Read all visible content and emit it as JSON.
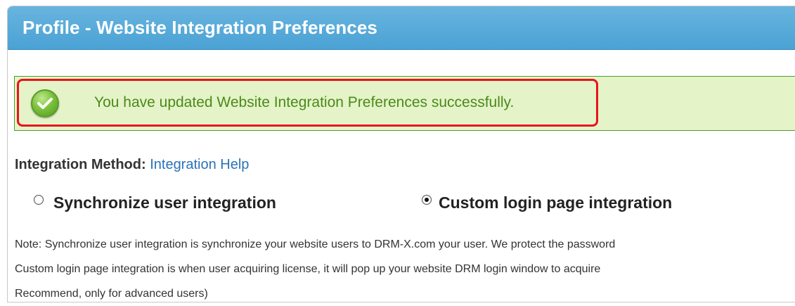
{
  "header": {
    "title": "Profile - Website Integration Preferences"
  },
  "alert": {
    "icon": "checkmark-icon",
    "message": "You have updated Website Integration Preferences successfully.",
    "colors": {
      "background": "#e5f3c8",
      "text": "#4a8a1a",
      "highlight": "#e8141c"
    }
  },
  "integration": {
    "label": "Integration Method:",
    "help_link": "Integration Help",
    "options": [
      {
        "label": "Synchronize user integration",
        "selected": false
      },
      {
        "label": "Custom login page integration",
        "selected": true
      }
    ]
  },
  "notes": [
    "Note: Synchronize user integration is synchronize your website users to DRM-X.com your user. We protect the password",
    "Custom login page integration is when user acquiring license, it will pop up your website DRM login window to acquire",
    "Recommend, only for advanced users)"
  ]
}
